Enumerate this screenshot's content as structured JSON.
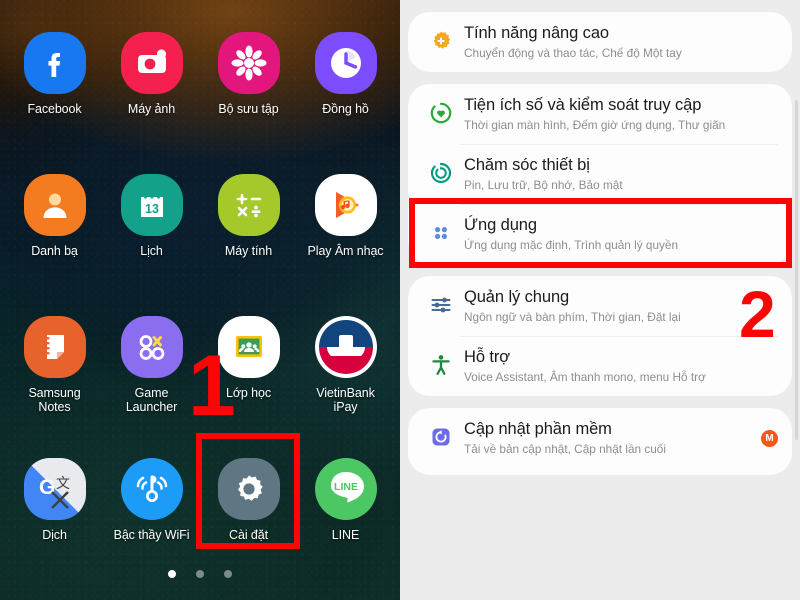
{
  "home": {
    "apps": [
      {
        "label": "Facebook",
        "icon": "facebook-icon"
      },
      {
        "label": "Máy ảnh",
        "icon": "camera-icon"
      },
      {
        "label": "Bộ sưu tập",
        "icon": "gallery-icon"
      },
      {
        "label": "Đồng hồ",
        "icon": "clock-icon"
      },
      {
        "label": "Danh bạ",
        "icon": "contacts-icon"
      },
      {
        "label": "Lịch",
        "icon": "calendar-icon"
      },
      {
        "label": "Máy tính",
        "icon": "calculator-icon"
      },
      {
        "label": "Play Âm nhạc",
        "icon": "play-music-icon"
      },
      {
        "label": "Samsung\nNotes",
        "icon": "samsung-notes-icon"
      },
      {
        "label": "Game\nLauncher",
        "icon": "game-launcher-icon"
      },
      {
        "label": "Lớp học",
        "icon": "google-classroom-icon"
      },
      {
        "label": "VietinBank\niPay",
        "icon": "vietinbank-icon"
      },
      {
        "label": "Dịch",
        "icon": "google-translate-icon"
      },
      {
        "label": "Bậc thầy WiFi",
        "icon": "wifi-master-icon"
      },
      {
        "label": "Cài đặt",
        "icon": "settings-gear-icon"
      },
      {
        "label": "LINE",
        "icon": "line-icon"
      }
    ],
    "calendar_day": "13",
    "line_text": "LINE",
    "page_dots": {
      "count": 3,
      "active_index": 0
    }
  },
  "annotations": {
    "step_one": "1",
    "step_two": "2",
    "highlight_color": "#fb0606"
  },
  "settings": {
    "items": [
      {
        "title": "Tính năng nâng cao",
        "subtitle": "Chuyển động và thao tác, Chế độ Một tay",
        "icon": "advanced-features-icon",
        "icon_color": "#f5a623"
      },
      {
        "title": "Tiện ích số và kiểm soát truy cập",
        "subtitle": "Thời gian màn hình, Đếm giờ ứng dụng, Thư giãn",
        "icon": "digital-wellbeing-icon",
        "icon_color": "#2aa83c"
      },
      {
        "title": "Chăm sóc thiết bị",
        "subtitle": "Pin, Lưu trữ, Bộ nhớ, Bảo mật",
        "icon": "device-care-icon",
        "icon_color": "#059b80"
      },
      {
        "title": "Ứng dụng",
        "subtitle": "Ứng dụng mặc định, Trình quản lý quyền",
        "icon": "apps-grid-icon",
        "icon_color": "#5a8fe0"
      },
      {
        "title": "Quản lý chung",
        "subtitle": "Ngôn ngữ và bàn phím, Thời gian, Đặt lại",
        "icon": "general-management-icon",
        "icon_color": "#4a6b9a"
      },
      {
        "title": "Hỗ trợ",
        "subtitle": "Voice Assistant, Âm thanh mono, menu Hỗ trợ",
        "icon": "accessibility-icon",
        "icon_color": "#1d8a3f"
      },
      {
        "title": "Cập nhật phần mềm",
        "subtitle": "Tải về bản cập nhật, Cập nhật lần cuối",
        "icon": "software-update-icon",
        "icon_color": "#6c6ce8",
        "badge": "M"
      }
    ]
  }
}
